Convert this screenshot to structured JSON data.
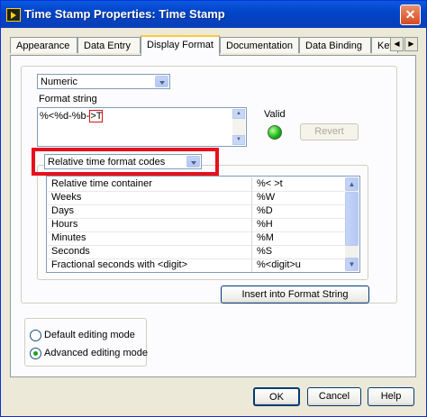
{
  "window": {
    "title": "Time Stamp Properties: Time Stamp"
  },
  "tabs": [
    {
      "label": "Appearance"
    },
    {
      "label": "Data Entry"
    },
    {
      "label": "Display Format"
    },
    {
      "label": "Documentation"
    },
    {
      "label": "Data Binding"
    },
    {
      "label": "Key"
    }
  ],
  "display_format": {
    "type_select": "Numeric",
    "format_string_label": "Format string",
    "format_string_prefix": "%<%d-%b-",
    "format_string_highlight": ">T",
    "valid_label": "Valid",
    "revert_label": "Revert",
    "codes_select": "Relative time format codes",
    "codes": [
      {
        "name": "Relative time container",
        "code": "%< >t"
      },
      {
        "name": "Weeks",
        "code": "%W"
      },
      {
        "name": "Days",
        "code": "%D"
      },
      {
        "name": "Hours",
        "code": "%H"
      },
      {
        "name": "Minutes",
        "code": "%M"
      },
      {
        "name": "Seconds",
        "code": "%S"
      },
      {
        "name": "Fractional seconds with <digit>",
        "code": "%<digit>u"
      }
    ],
    "insert_label": "Insert into Format String"
  },
  "editing_mode": {
    "default_label": "Default editing mode",
    "advanced_label": "Advanced editing mode",
    "selected": "advanced"
  },
  "buttons": {
    "ok": "OK",
    "cancel": "Cancel",
    "help": "Help"
  },
  "colors": {
    "titlebar": "#0a5ae0",
    "highlight": "#e8101c",
    "valid_led": "#1db81d"
  }
}
